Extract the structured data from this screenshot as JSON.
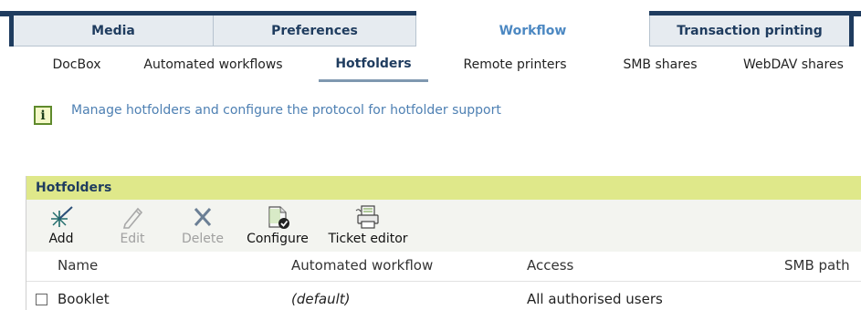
{
  "top_tabs": [
    {
      "label": "Media",
      "active": false
    },
    {
      "label": "Preferences",
      "active": false
    },
    {
      "label": "Workflow",
      "active": true
    },
    {
      "label": "Transaction printing",
      "active": false
    }
  ],
  "sub_tabs": [
    {
      "label": "DocBox",
      "active": false
    },
    {
      "label": "Automated workflows",
      "active": false
    },
    {
      "label": "Hotfolders",
      "active": true
    },
    {
      "label": "Remote printers",
      "active": false
    },
    {
      "label": "SMB shares",
      "active": false
    },
    {
      "label": "WebDAV shares",
      "active": false
    }
  ],
  "info": {
    "icon": "info-icon",
    "text": "Manage hotfolders and configure the protocol for hotfolder support"
  },
  "panel": {
    "title": "Hotfolders",
    "toolbar": [
      {
        "label": "Add",
        "icon": "add-sparkle-icon",
        "enabled": true
      },
      {
        "label": "Edit",
        "icon": "pencil-icon",
        "enabled": false
      },
      {
        "label": "Delete",
        "icon": "x-icon",
        "enabled": false
      },
      {
        "label": "Configure",
        "icon": "document-check-icon",
        "enabled": true
      },
      {
        "label": "Ticket editor",
        "icon": "ticket-printer-icon",
        "enabled": true
      }
    ],
    "columns": [
      "Name",
      "Automated workflow",
      "Access",
      "SMB path"
    ],
    "rows": [
      {
        "name": "Booklet",
        "workflow": "(default)",
        "access": "All authorised users"
      }
    ]
  },
  "colors": {
    "navy": "#1f3c5f",
    "tab_bg": "#e6ebf0",
    "active_blue": "#4c88c2",
    "header_yellow": "#dfe88a",
    "info_text": "#4e80b3"
  }
}
